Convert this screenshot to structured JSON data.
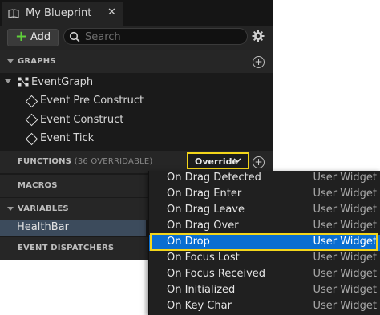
{
  "window": {
    "tab_title": "My Blueprint",
    "close_glyph": "✕",
    "tab_icon": "blueprint-book-icon"
  },
  "toolbar": {
    "add_plus": "+",
    "add_label": "Add",
    "search_placeholder": "Search",
    "settings_icon": "gear-icon"
  },
  "graphs": {
    "header": "GRAPHS",
    "event_graph": "EventGraph",
    "events": [
      "Event Pre Construct",
      "Event Construct",
      "Event Tick"
    ]
  },
  "functions": {
    "header": "FUNCTIONS",
    "sub": "(36 OVERRIDABLE)",
    "override_label": "Override"
  },
  "macros": {
    "header": "MACROS"
  },
  "variables": {
    "header": "VARIABLES",
    "items": [
      "HealthBar"
    ]
  },
  "event_dispatchers": {
    "header": "EVENT DISPATCHERS"
  },
  "override_menu": {
    "selected_index": 4,
    "items": [
      {
        "name": "On Drag Detected",
        "type": "User Widget"
      },
      {
        "name": "On Drag Enter",
        "type": "User Widget"
      },
      {
        "name": "On Drag Leave",
        "type": "User Widget"
      },
      {
        "name": "On Drag Over",
        "type": "User Widget"
      },
      {
        "name": "On Drop",
        "type": "User Widget"
      },
      {
        "name": "On Focus Lost",
        "type": "User Widget"
      },
      {
        "name": "On Focus Received",
        "type": "User Widget"
      },
      {
        "name": "On Initialized",
        "type": "User Widget"
      },
      {
        "name": "On Key Char",
        "type": "User Widget"
      }
    ]
  },
  "colors": {
    "highlight_outline": "#f3d51a",
    "selection": "#0a6ed1",
    "add_plus": "#5fcf3a",
    "variable_row": "#3c4b5c"
  }
}
